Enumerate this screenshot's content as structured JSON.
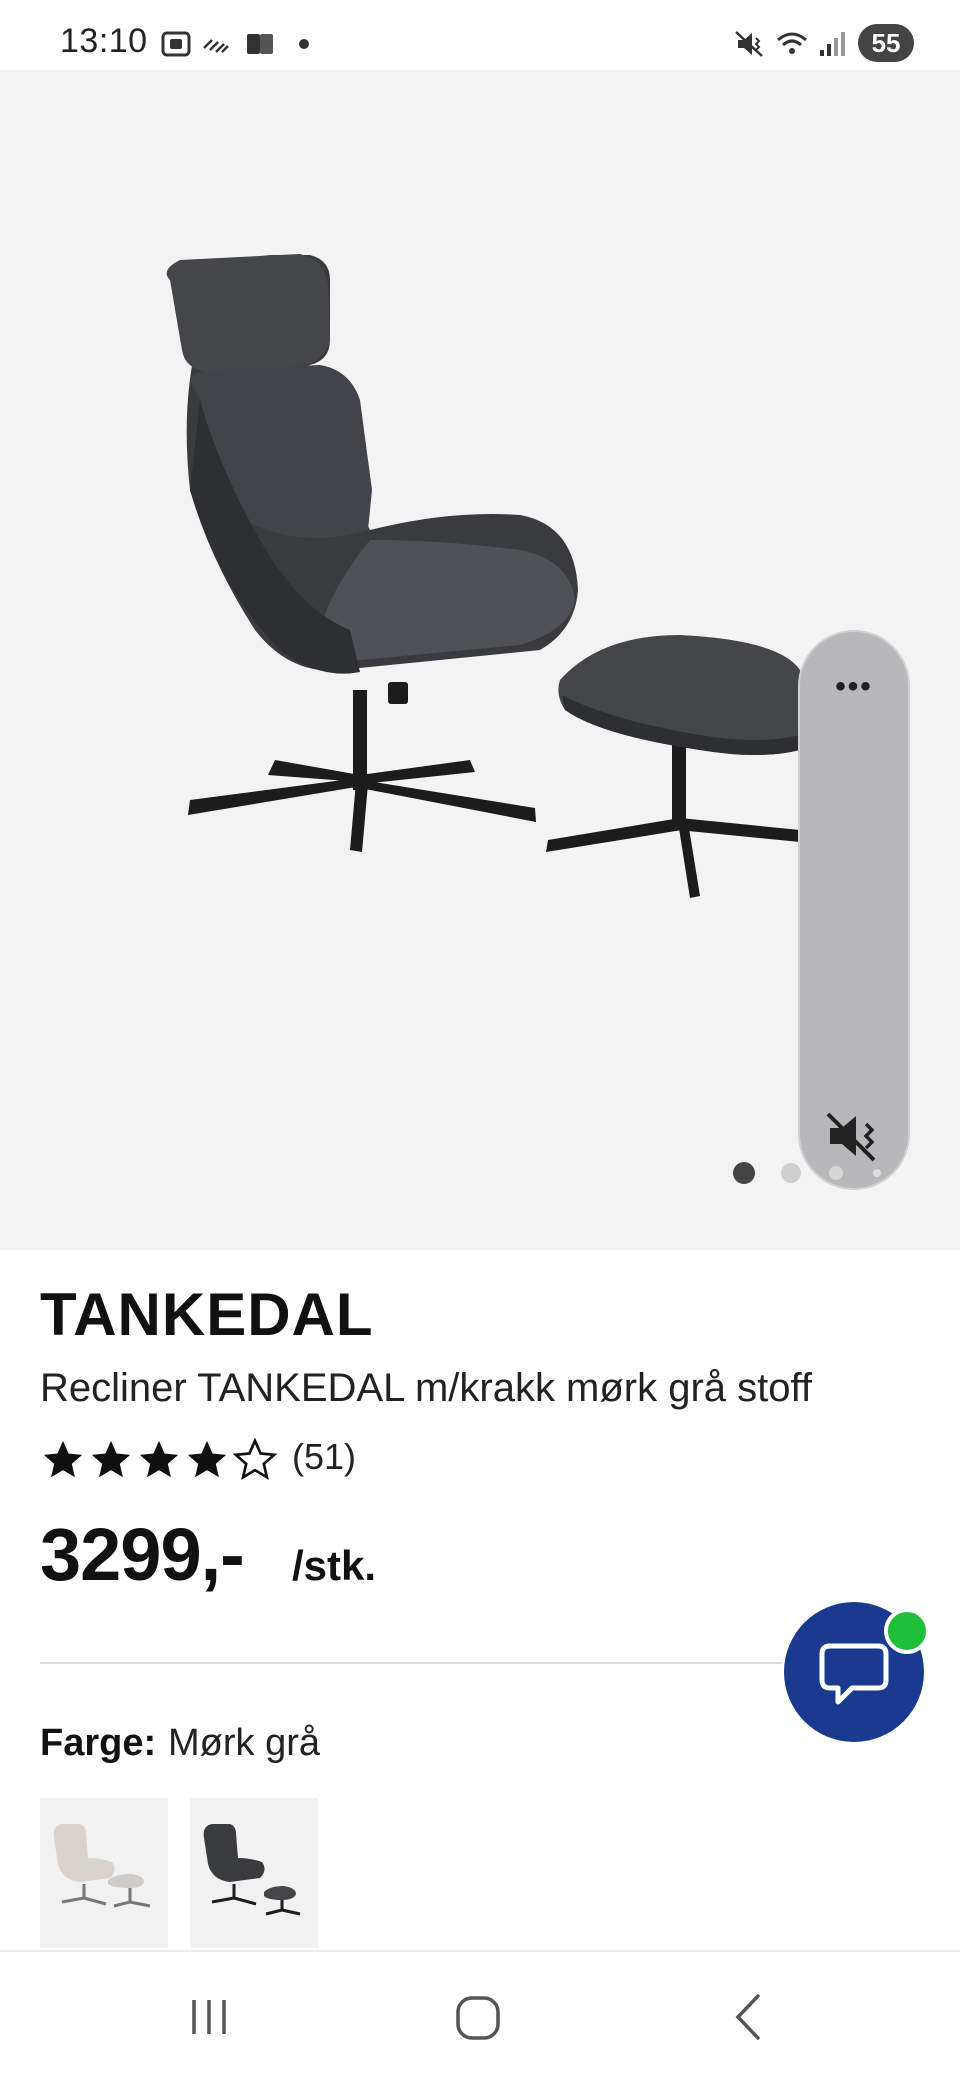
{
  "status_bar": {
    "time": "13:10",
    "battery": "55",
    "left_icons": [
      "screenshot-icon",
      "haze-icon",
      "cards-icon",
      "dot-icon"
    ],
    "right_icons": [
      "mute-vibrate-icon",
      "wifi-5g-icon",
      "signal-icon"
    ]
  },
  "gallery": {
    "image_subject": "dark grey recliner chair with footstool",
    "page_count": 4,
    "active_index": 0
  },
  "volume_panel": {
    "more_label": "•••",
    "mode_icon": "mute-vibrate-icon"
  },
  "product": {
    "brand": "TANKEDAL",
    "name": "Recliner TANKEDAL m/krakk mørk grå stoff",
    "rating": 4,
    "rating_max": 5,
    "review_count": "(51)",
    "price": "3299,-",
    "unit": "/stk."
  },
  "color_selector": {
    "label": "Farge:",
    "value": "Mørk grå",
    "options": [
      {
        "name": "light-beige-option",
        "selected": false
      },
      {
        "name": "dark-grey-option",
        "selected": true
      }
    ]
  },
  "chat": {
    "icon": "chat-bubble-icon",
    "badge_color": "#1fbf3a"
  },
  "nav_bar": {
    "buttons": [
      "recent-apps-icon",
      "home-icon",
      "back-icon"
    ]
  },
  "colors": {
    "accent": "#1a3a8f",
    "hero_background": "#f3f3f3"
  }
}
